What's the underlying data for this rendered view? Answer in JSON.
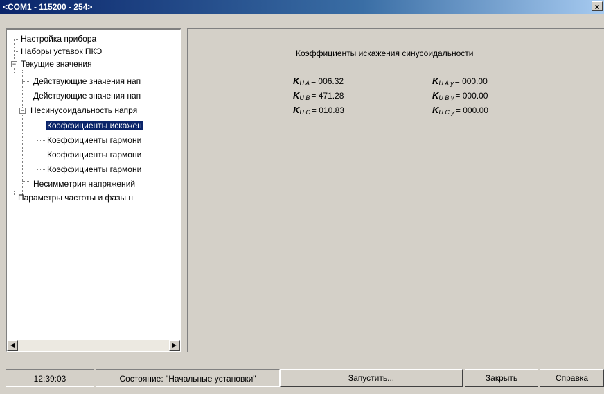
{
  "window": {
    "title": "<COM1 - 115200 - 254>",
    "close_glyph": "x"
  },
  "tree": {
    "items": [
      {
        "label": "Настройка прибора"
      },
      {
        "label": "Наборы уставок ПКЭ"
      },
      {
        "label": "Текущие значения",
        "expander": "−"
      },
      {
        "label": "Действующие значения нап"
      },
      {
        "label": "Действующие значения нап"
      },
      {
        "label": "Несинусоидальность напря",
        "expander": "−"
      },
      {
        "label": "Коэффициенты искажен",
        "selected": true
      },
      {
        "label": "Коэффициенты гармони"
      },
      {
        "label": "Коэффициенты гармони"
      },
      {
        "label": "Коэффициенты гармони"
      },
      {
        "label": "Несимметрия напряжений"
      },
      {
        "label": "Параметры частоты и фазы н"
      }
    ],
    "scroll_left_glyph": "◀",
    "scroll_right_glyph": "▶"
  },
  "panel": {
    "heading": "Коэффициенты искажения синусоидальности",
    "left": [
      {
        "k": "K",
        "sub": "U A",
        "value": "= 006.32"
      },
      {
        "k": "K",
        "sub": "U B",
        "value": "= 471.28"
      },
      {
        "k": "K",
        "sub": "U C",
        "value": "= 010.83"
      }
    ],
    "right": [
      {
        "k": "K",
        "sub": "U A y",
        "value": "= 000.00"
      },
      {
        "k": "K",
        "sub": "U B y",
        "value": "= 000.00"
      },
      {
        "k": "K",
        "sub": "U C y",
        "value": "= 000.00"
      }
    ]
  },
  "statusbar": {
    "time": "12:39:03",
    "status": "Состояние: \"Начальные установки\"",
    "run_label": "Запустить...",
    "close_label": "Закрыть",
    "help_label": "Справка"
  }
}
